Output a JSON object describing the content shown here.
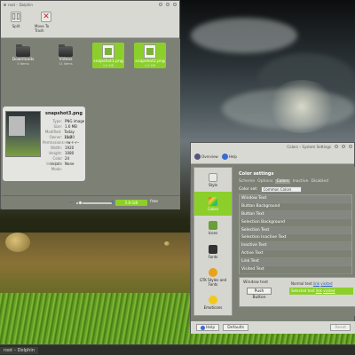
{
  "colors": {
    "accent": "#8ccf2b",
    "window_bg": "#7d8075",
    "chrome_bg": "#d9d9d4"
  },
  "dolphin": {
    "title": "root – Dolphin",
    "toolbar": [
      {
        "label": "Split",
        "icon": "split-view-icon"
      },
      {
        "label": "Move To Trash",
        "icon": "trash-icon"
      }
    ],
    "items": [
      {
        "name": "Downloads",
        "sub": "0 items",
        "type": "folder"
      },
      {
        "name": "Videos",
        "sub": "11 items",
        "type": "folder"
      },
      {
        "name": "snapshot1.png",
        "sub": "5.6 MB",
        "type": "image",
        "selected": true
      },
      {
        "name": "snapshot2.png",
        "sub": "5.6 MB",
        "type": "image",
        "selected": true
      }
    ],
    "info": {
      "filename": "snapshot3.png",
      "rows": [
        {
          "k": "Type:",
          "v": "PNG image"
        },
        {
          "k": "Size:",
          "v": "1.6 MB"
        },
        {
          "k": "Modified:",
          "v": "Today 11:20"
        },
        {
          "k": "Owner:",
          "v": "root"
        },
        {
          "k": "Permissions:",
          "v": "-rw-r--r--"
        },
        {
          "k": "Width:",
          "v": "1920"
        },
        {
          "k": "Height:",
          "v": "1080"
        },
        {
          "k": "Color depth:",
          "v": "24"
        },
        {
          "k": "Interlace Mode:",
          "v": "None"
        }
      ]
    },
    "status": {
      "free_space": "5.8 GiB",
      "free_label": "free",
      "zoom_minus": "−",
      "zoom_plus": "+"
    }
  },
  "settings": {
    "title": "Colors – System Settings",
    "toolbar": {
      "overview": "Overview",
      "help": "Help"
    },
    "sidebar": [
      {
        "label": "Style",
        "icon": "style-icon"
      },
      {
        "label": "Colors",
        "icon": "colors-icon",
        "selected": true
      },
      {
        "label": "Icons",
        "icon": "icons-icon"
      },
      {
        "label": "Fonts",
        "icon": "fonts-icon"
      },
      {
        "label": "GTK Styles and Fonts",
        "icon": "gtk-icon"
      },
      {
        "label": "Emoticons",
        "icon": "emoticons-icon"
      }
    ],
    "heading": "Color settings",
    "tabs": [
      "Scheme",
      "Options",
      "Colors",
      "Inactive",
      "Disabled"
    ],
    "active_tab": "Colors",
    "color_set_label": "Color set:",
    "color_set_value": "Common Colors",
    "roles": [
      "Window Text",
      "Button Background",
      "Button Text",
      "Selection Background",
      "Selection Text",
      "Selection Inactive Text",
      "Inactive Text",
      "Active Text",
      "Link Text",
      "Visited Text",
      "Negative Text"
    ],
    "preview": {
      "window_text": "Window text",
      "push_button": "Push Button",
      "normal_text": "Normal text",
      "selected_text": "Selected text",
      "link": "link",
      "visited": "visited"
    },
    "bottom": {
      "help": "Help",
      "defaults": "Defaults",
      "reset": "Reset"
    }
  },
  "taskbar": {
    "task": "root – Dolphin"
  }
}
